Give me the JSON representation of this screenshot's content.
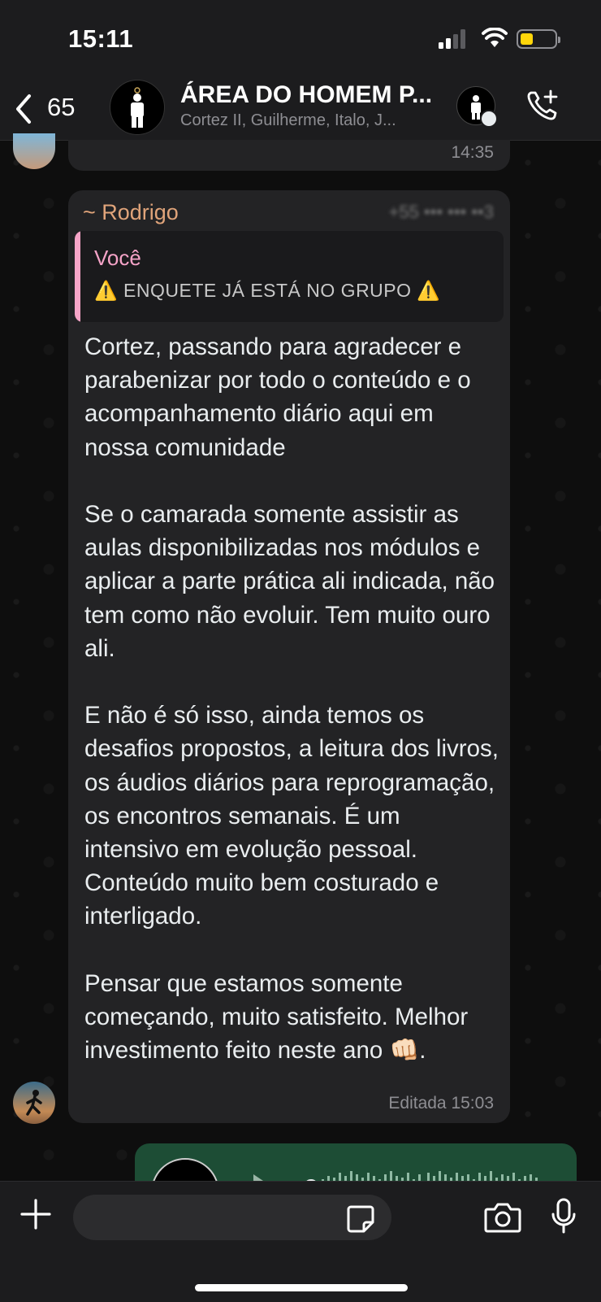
{
  "status_bar": {
    "time": "15:11",
    "icons": [
      "signal-icon",
      "wifi-icon",
      "battery-icon"
    ],
    "battery_color": "#ffd60a"
  },
  "header": {
    "back_count": "65",
    "group_title": "ÁREA DO HOMEM P...",
    "group_subtitle": "Cortez II, Guilherme, Italo, J...",
    "icons": [
      "back-chevron-icon",
      "group-avatar",
      "member-avatar",
      "add-call-icon"
    ]
  },
  "previous_message": {
    "time": "14:35"
  },
  "message": {
    "sender": "~ Rodrigo",
    "sender_color": "#e0a47a",
    "quoted_author": "Você",
    "quoted_text": "⚠️ ENQUETE JÁ ESTÁ NO GRUPO ⚠️",
    "quote_bar_color": "#f7a5c8",
    "paragraphs": [
      "Cortez, passando para agradecer e parabenizar por todo o conteúdo e o acompanhamento diário aqui em nossa comunidade",
      "Se o camarada somente assistir as aulas disponibilizadas nos módulos e aplicar a parte prática ali indicada, não tem como não evoluir. Tem muito ouro ali.",
      "E não é só isso, ainda temos os desafios propostos, a leitura dos livros, os áudios diários para reprogramação, os encontros semanais. É um intensivo em evolução pessoal. Conteúdo muito bem costurado e interligado.",
      "Pensar que estamos somente começando, muito satisfeito. Melhor investimento feito neste ano 👊🏻."
    ],
    "edited_time": "Editada 15:03"
  },
  "audio_message": {
    "bubble_color": "#1d4d35",
    "icons": [
      "play-icon",
      "waveform"
    ]
  },
  "input_bar": {
    "icons": [
      "plus-icon",
      "sticker-icon",
      "camera-icon",
      "mic-icon"
    ]
  }
}
